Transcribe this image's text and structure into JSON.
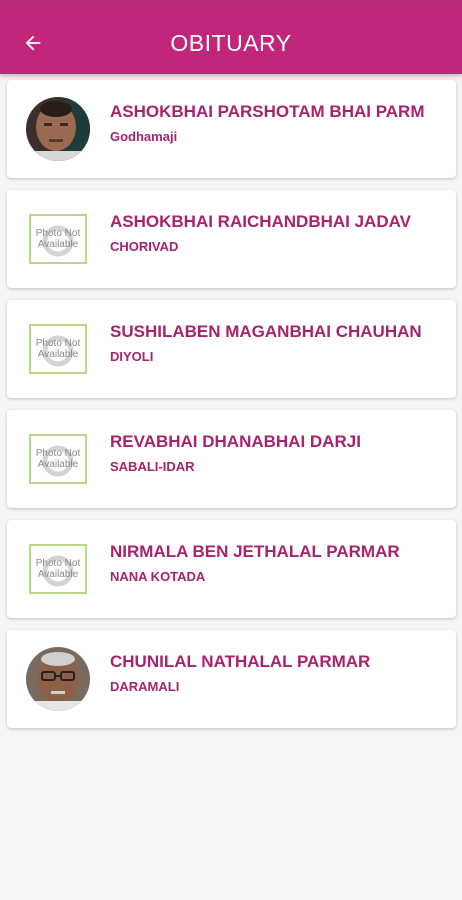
{
  "app": {
    "title": "OBITUARY",
    "back_icon": "arrow-left-icon",
    "accent": "#c1267a",
    "text_color": "#a8226e"
  },
  "placeholder_text": "Photo Not Available",
  "items": [
    {
      "name": "ASHOKBHAI PARSHOTAM BHAI PARM",
      "place": "Godhamaji",
      "photo": "portrait-1"
    },
    {
      "name": "ASHOKBHAI RAICHANDBHAI JADAV",
      "place": "CHORIVAD",
      "photo": "placeholder"
    },
    {
      "name": "SUSHILABEN MAGANBHAI CHAUHAN",
      "place": "DIYOLI",
      "photo": "placeholder"
    },
    {
      "name": "REVABHAI DHANABHAI DARJI",
      "place": "SABALI-IDAR",
      "photo": "placeholder"
    },
    {
      "name": "NIRMALA BEN JETHALAL PARMAR",
      "place": "NANA KOTADA",
      "photo": "placeholder"
    },
    {
      "name": "CHUNILAL NATHALAL PARMAR",
      "place": "DARAMALI",
      "photo": "portrait-2"
    }
  ]
}
